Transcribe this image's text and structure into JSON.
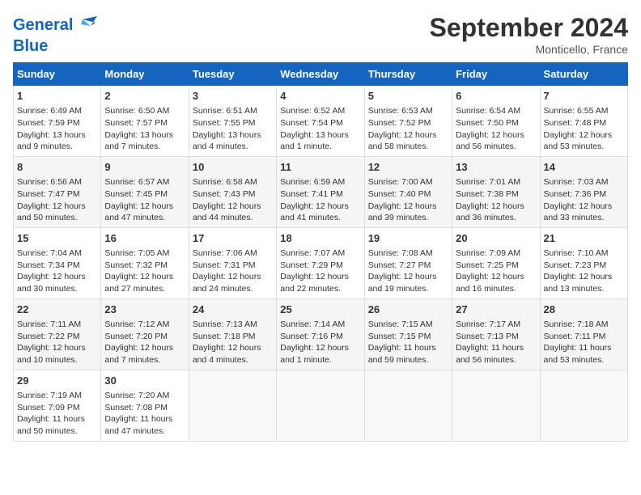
{
  "logo": {
    "line1": "General",
    "line2": "Blue"
  },
  "title": "September 2024",
  "subtitle": "Monticello, France",
  "days_of_week": [
    "Sunday",
    "Monday",
    "Tuesday",
    "Wednesday",
    "Thursday",
    "Friday",
    "Saturday"
  ],
  "weeks": [
    [
      {
        "day": 1,
        "lines": [
          "Sunrise: 6:49 AM",
          "Sunset: 7:59 PM",
          "Daylight: 13 hours",
          "and 9 minutes."
        ]
      },
      {
        "day": 2,
        "lines": [
          "Sunrise: 6:50 AM",
          "Sunset: 7:57 PM",
          "Daylight: 13 hours",
          "and 7 minutes."
        ]
      },
      {
        "day": 3,
        "lines": [
          "Sunrise: 6:51 AM",
          "Sunset: 7:55 PM",
          "Daylight: 13 hours",
          "and 4 minutes."
        ]
      },
      {
        "day": 4,
        "lines": [
          "Sunrise: 6:52 AM",
          "Sunset: 7:54 PM",
          "Daylight: 13 hours",
          "and 1 minute."
        ]
      },
      {
        "day": 5,
        "lines": [
          "Sunrise: 6:53 AM",
          "Sunset: 7:52 PM",
          "Daylight: 12 hours",
          "and 58 minutes."
        ]
      },
      {
        "day": 6,
        "lines": [
          "Sunrise: 6:54 AM",
          "Sunset: 7:50 PM",
          "Daylight: 12 hours",
          "and 56 minutes."
        ]
      },
      {
        "day": 7,
        "lines": [
          "Sunrise: 6:55 AM",
          "Sunset: 7:48 PM",
          "Daylight: 12 hours",
          "and 53 minutes."
        ]
      }
    ],
    [
      {
        "day": 8,
        "lines": [
          "Sunrise: 6:56 AM",
          "Sunset: 7:47 PM",
          "Daylight: 12 hours",
          "and 50 minutes."
        ]
      },
      {
        "day": 9,
        "lines": [
          "Sunrise: 6:57 AM",
          "Sunset: 7:45 PM",
          "Daylight: 12 hours",
          "and 47 minutes."
        ]
      },
      {
        "day": 10,
        "lines": [
          "Sunrise: 6:58 AM",
          "Sunset: 7:43 PM",
          "Daylight: 12 hours",
          "and 44 minutes."
        ]
      },
      {
        "day": 11,
        "lines": [
          "Sunrise: 6:59 AM",
          "Sunset: 7:41 PM",
          "Daylight: 12 hours",
          "and 41 minutes."
        ]
      },
      {
        "day": 12,
        "lines": [
          "Sunrise: 7:00 AM",
          "Sunset: 7:40 PM",
          "Daylight: 12 hours",
          "and 39 minutes."
        ]
      },
      {
        "day": 13,
        "lines": [
          "Sunrise: 7:01 AM",
          "Sunset: 7:38 PM",
          "Daylight: 12 hours",
          "and 36 minutes."
        ]
      },
      {
        "day": 14,
        "lines": [
          "Sunrise: 7:03 AM",
          "Sunset: 7:36 PM",
          "Daylight: 12 hours",
          "and 33 minutes."
        ]
      }
    ],
    [
      {
        "day": 15,
        "lines": [
          "Sunrise: 7:04 AM",
          "Sunset: 7:34 PM",
          "Daylight: 12 hours",
          "and 30 minutes."
        ]
      },
      {
        "day": 16,
        "lines": [
          "Sunrise: 7:05 AM",
          "Sunset: 7:32 PM",
          "Daylight: 12 hours",
          "and 27 minutes."
        ]
      },
      {
        "day": 17,
        "lines": [
          "Sunrise: 7:06 AM",
          "Sunset: 7:31 PM",
          "Daylight: 12 hours",
          "and 24 minutes."
        ]
      },
      {
        "day": 18,
        "lines": [
          "Sunrise: 7:07 AM",
          "Sunset: 7:29 PM",
          "Daylight: 12 hours",
          "and 22 minutes."
        ]
      },
      {
        "day": 19,
        "lines": [
          "Sunrise: 7:08 AM",
          "Sunset: 7:27 PM",
          "Daylight: 12 hours",
          "and 19 minutes."
        ]
      },
      {
        "day": 20,
        "lines": [
          "Sunrise: 7:09 AM",
          "Sunset: 7:25 PM",
          "Daylight: 12 hours",
          "and 16 minutes."
        ]
      },
      {
        "day": 21,
        "lines": [
          "Sunrise: 7:10 AM",
          "Sunset: 7:23 PM",
          "Daylight: 12 hours",
          "and 13 minutes."
        ]
      }
    ],
    [
      {
        "day": 22,
        "lines": [
          "Sunrise: 7:11 AM",
          "Sunset: 7:22 PM",
          "Daylight: 12 hours",
          "and 10 minutes."
        ]
      },
      {
        "day": 23,
        "lines": [
          "Sunrise: 7:12 AM",
          "Sunset: 7:20 PM",
          "Daylight: 12 hours",
          "and 7 minutes."
        ]
      },
      {
        "day": 24,
        "lines": [
          "Sunrise: 7:13 AM",
          "Sunset: 7:18 PM",
          "Daylight: 12 hours",
          "and 4 minutes."
        ]
      },
      {
        "day": 25,
        "lines": [
          "Sunrise: 7:14 AM",
          "Sunset: 7:16 PM",
          "Daylight: 12 hours",
          "and 1 minute."
        ]
      },
      {
        "day": 26,
        "lines": [
          "Sunrise: 7:15 AM",
          "Sunset: 7:15 PM",
          "Daylight: 11 hours",
          "and 59 minutes."
        ]
      },
      {
        "day": 27,
        "lines": [
          "Sunrise: 7:17 AM",
          "Sunset: 7:13 PM",
          "Daylight: 11 hours",
          "and 56 minutes."
        ]
      },
      {
        "day": 28,
        "lines": [
          "Sunrise: 7:18 AM",
          "Sunset: 7:11 PM",
          "Daylight: 11 hours",
          "and 53 minutes."
        ]
      }
    ],
    [
      {
        "day": 29,
        "lines": [
          "Sunrise: 7:19 AM",
          "Sunset: 7:09 PM",
          "Daylight: 11 hours",
          "and 50 minutes."
        ]
      },
      {
        "day": 30,
        "lines": [
          "Sunrise: 7:20 AM",
          "Sunset: 7:08 PM",
          "Daylight: 11 hours",
          "and 47 minutes."
        ]
      },
      null,
      null,
      null,
      null,
      null
    ]
  ]
}
